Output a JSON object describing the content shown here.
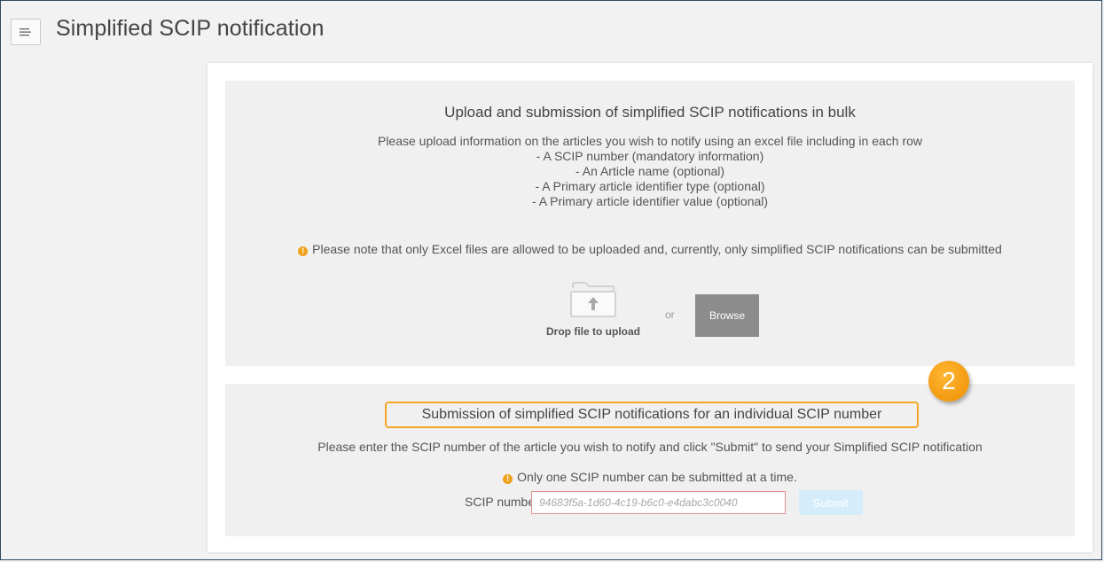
{
  "header": {
    "title": "Simplified SCIP notification",
    "menu_icon": "menu-icon"
  },
  "bulk": {
    "heading": "Upload and submission of simplified SCIP notifications in bulk",
    "intro": "Please upload information on the articles you wish to notify using an excel file including in each row",
    "items": [
      "- A SCIP number (mandatory information)",
      "- An Article name (optional)",
      "- A Primary article identifier type (optional)",
      "- A Primary article identifier value (optional)"
    ],
    "note": "Please note that only Excel files are allowed to be uploaded and, currently, only simplified SCIP notifications can be submitted",
    "drop_label": "Drop file to upload",
    "or_text": "or",
    "browse_label": "Browse"
  },
  "individual": {
    "heading": "Submission of simplified SCIP notifications for an individual SCIP number",
    "intro": "Please enter the SCIP number of the article you wish to notify and click \"Submit\" to send your Simplified SCIP notification",
    "note": "Only one SCIP number can be submitted at a time.",
    "scip_label": "SCIP number",
    "scip_placeholder": "94683f5a-1d60-4c19-b6c0-e4dabc3c0040",
    "submit_label": "Submit"
  },
  "annotation": {
    "step_number": "2"
  },
  "colors": {
    "accent_orange": "#f5a623",
    "browse_gray": "#8c8c8c",
    "submit_disabled": "#d5ecfb",
    "input_error_border": "#e0908b"
  }
}
